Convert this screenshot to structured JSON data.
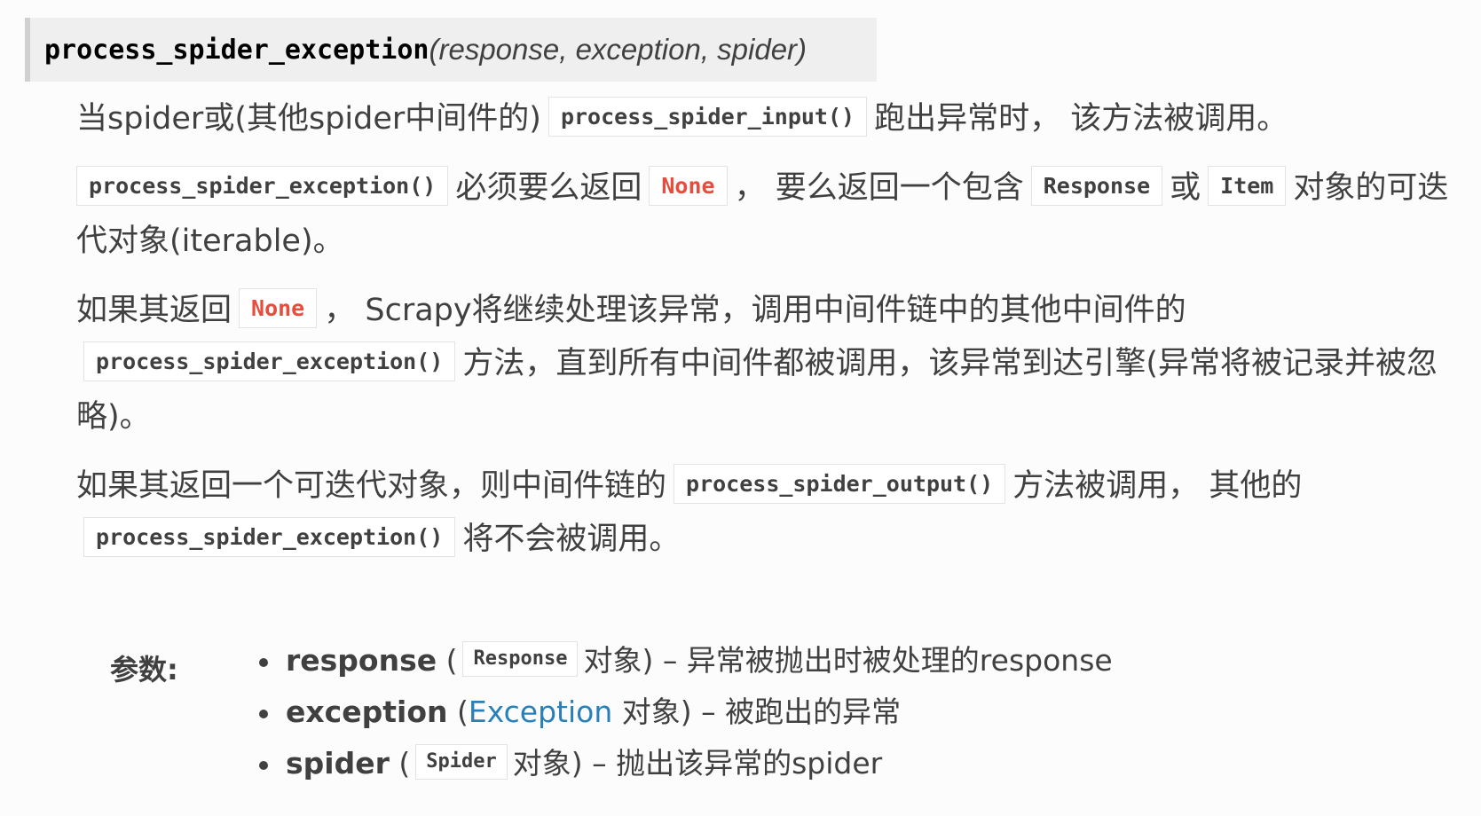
{
  "signature": {
    "name": "process_spider_exception",
    "params": "(response, exception, spider)"
  },
  "paragraphs": {
    "p1": {
      "t1": "当spider或(其他spider中间件的)",
      "c1": "process_spider_input()",
      "t2": "跑出异常时， 该方法被调用。"
    },
    "p2": {
      "c1": "process_spider_exception()",
      "t1": "必须要么返回",
      "c2": "None",
      "t2": "， 要么返回一个包含",
      "c3": "Response",
      "t3": "或",
      "c4": "Item",
      "t4": "对象的可迭代对象(iterable)。"
    },
    "p3": {
      "t1": "如果其返回",
      "c1": "None",
      "t2": "， Scrapy将继续处理该异常，调用中间件链中的其他中间件的",
      "c2": "process_spider_exception()",
      "t3": "方法，直到所有中间件都被调用，该异常到达引擎(异常将被记录并被忽略)。"
    },
    "p4": {
      "t1": "如果其返回一个可迭代对象，则中间件链的",
      "c1": "process_spider_output()",
      "t2": "方法被调用， 其他的",
      "c2": "process_spider_exception()",
      "t3": "将不会被调用。"
    }
  },
  "params_section": {
    "label": "参数:",
    "items": [
      {
        "name": "response",
        "open": " (",
        "code": "Response",
        "rest": "对象) – 异常被抛出时被处理的response"
      },
      {
        "name": "exception",
        "open": " (",
        "link": "Exception",
        "rest": " 对象) – 被跑出的异常"
      },
      {
        "name": "spider",
        "open": " (",
        "code": "Spider",
        "rest": "对象) – 抛出该异常的spider"
      }
    ]
  },
  "colors": {
    "text": "#404040",
    "literal_red": "#e74c3c",
    "link": "#2980b9",
    "signature_bg": "#efefef",
    "signature_border": "#d0d0d0"
  }
}
